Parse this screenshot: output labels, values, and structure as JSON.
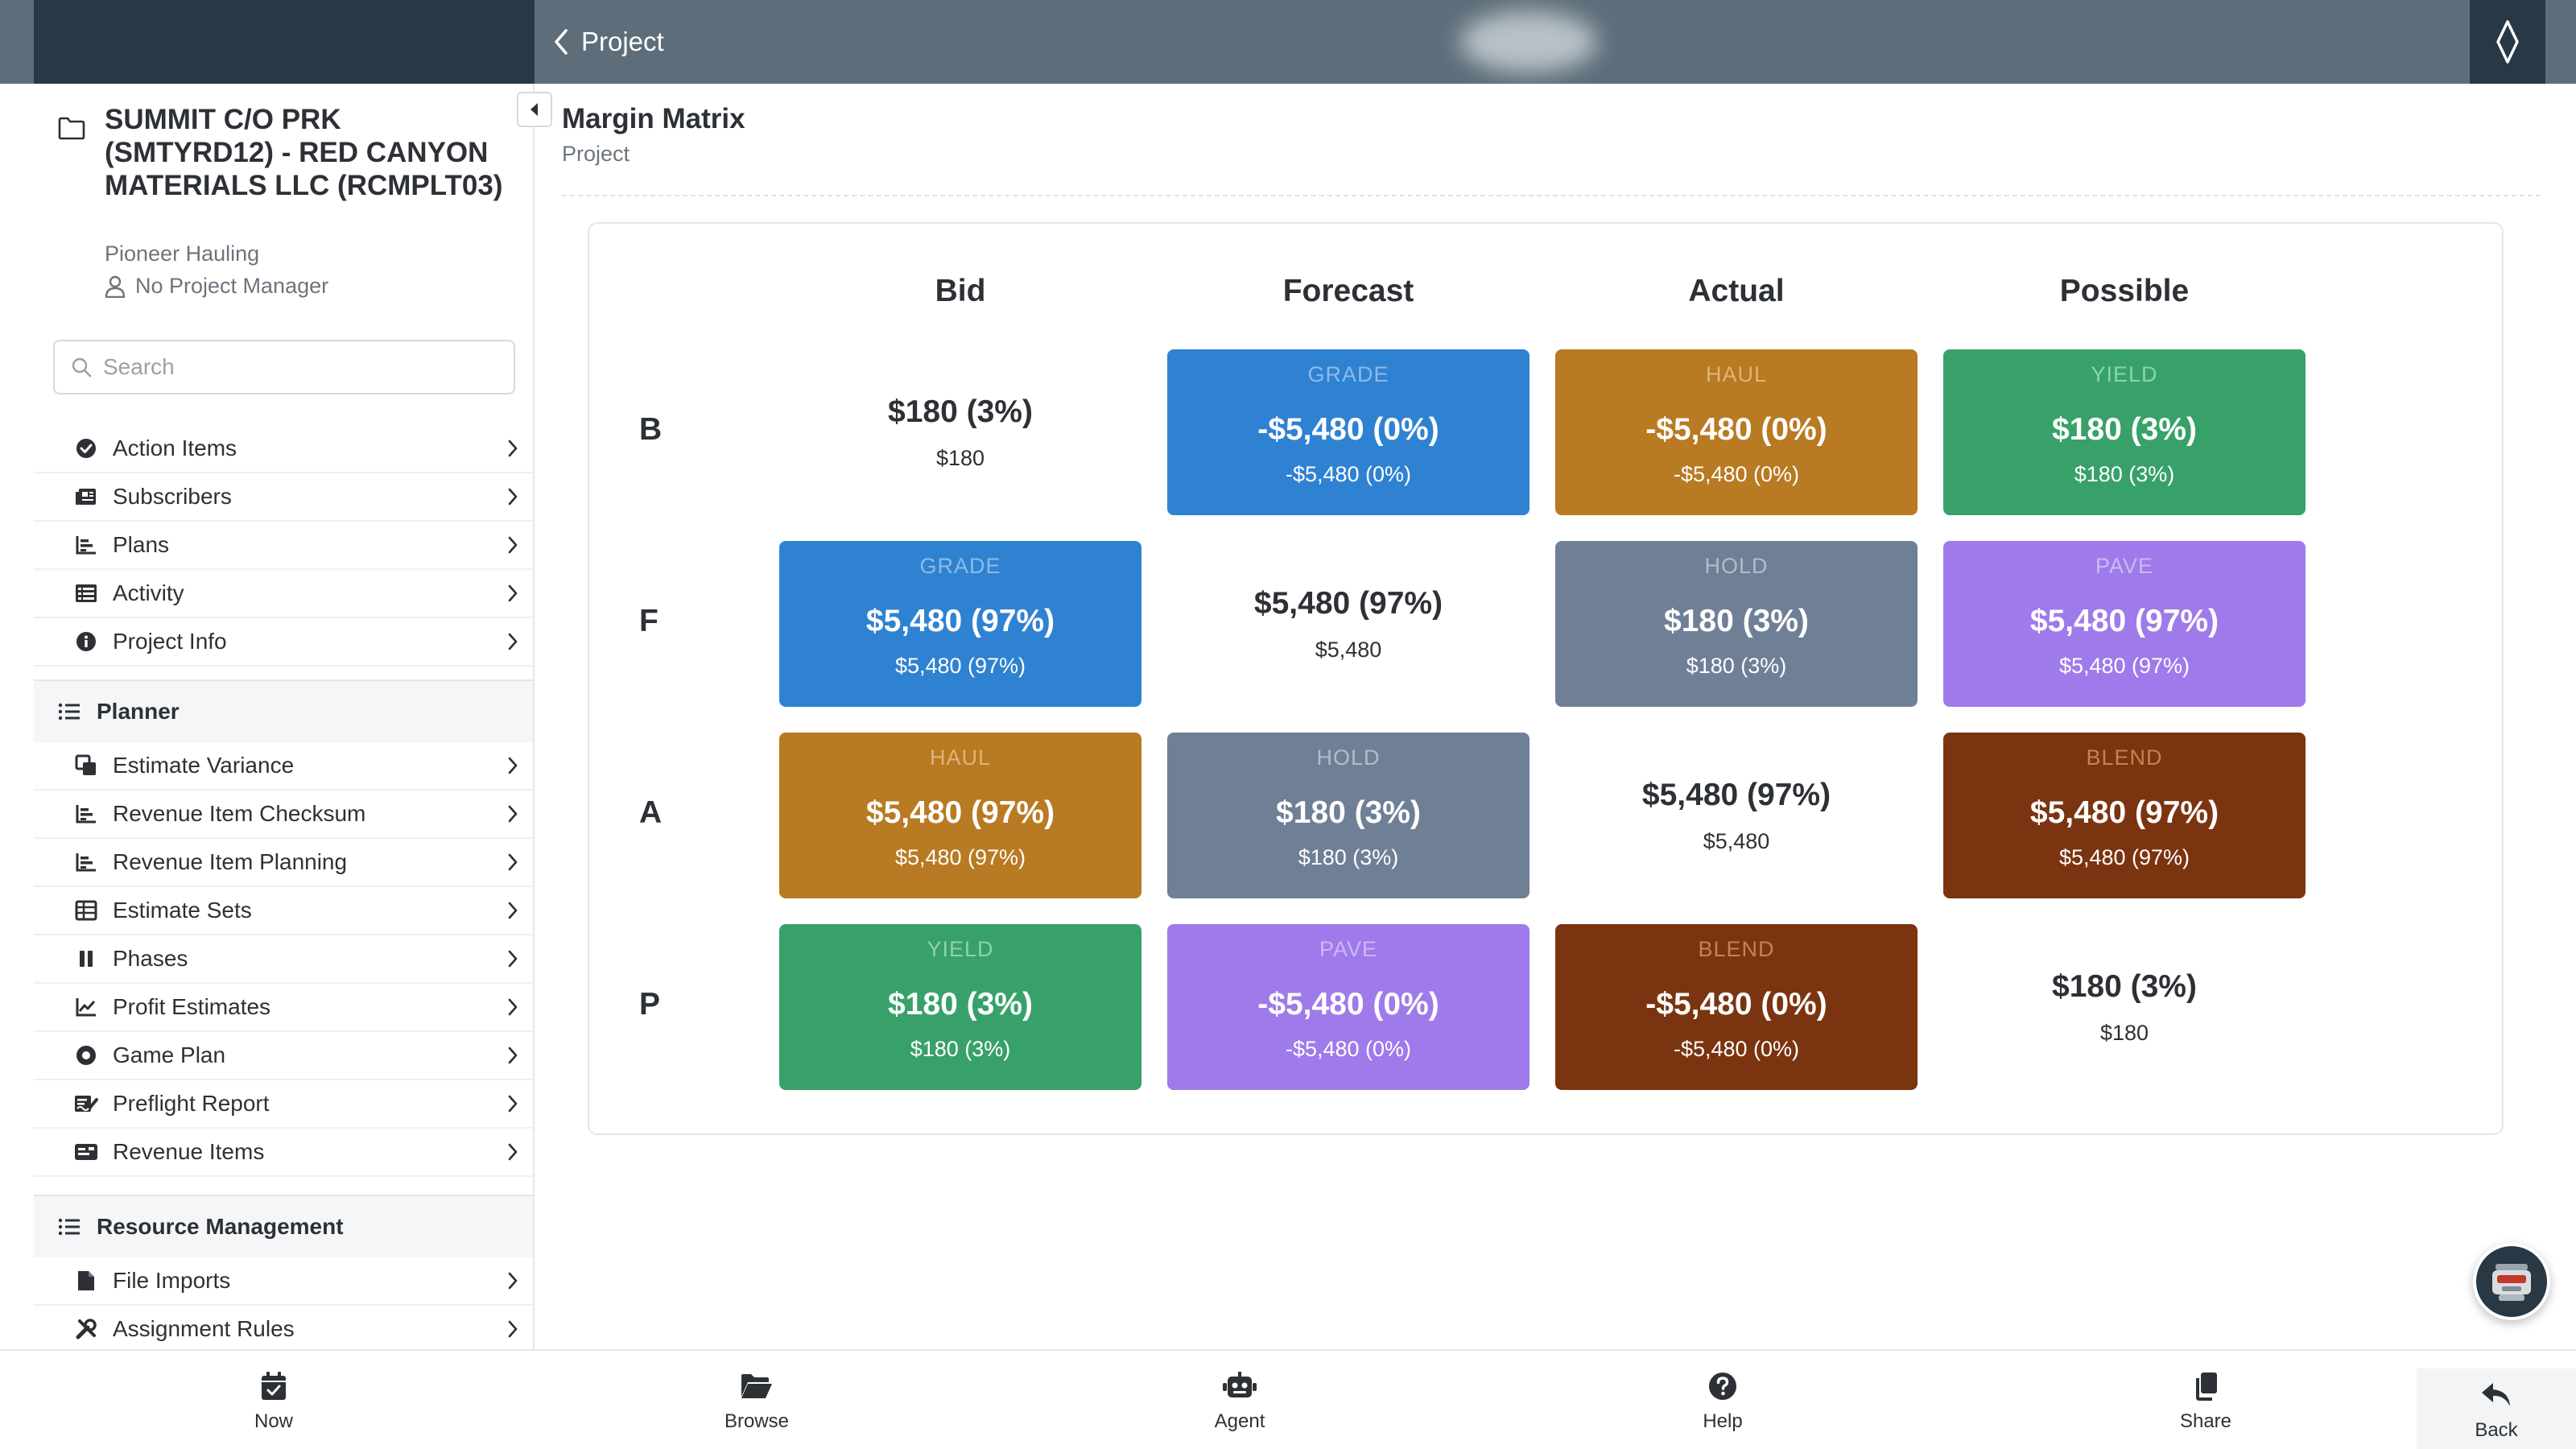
{
  "header": {
    "back_label": "Project"
  },
  "project": {
    "title": "SUMMIT C/O PRK (SMTYRD12) - RED CANYON MATERIALS LLC (RCMPLT03)",
    "company": "Pioneer Hauling",
    "manager": "No Project Manager"
  },
  "search": {
    "placeholder": "Search",
    "value": ""
  },
  "nav_top": [
    {
      "label": "Action Items",
      "icon": "check-circle-icon"
    },
    {
      "label": "Subscribers",
      "icon": "newspaper-icon"
    },
    {
      "label": "Plans",
      "icon": "chart-bar-icon"
    },
    {
      "label": "Activity",
      "icon": "list-icon"
    },
    {
      "label": "Project Info",
      "icon": "info-circle-icon"
    }
  ],
  "sections": {
    "planner": {
      "title": "Planner",
      "items": [
        {
          "label": "Estimate Variance",
          "icon": "clone-icon"
        },
        {
          "label": "Revenue Item Checksum",
          "icon": "chart-bar-icon"
        },
        {
          "label": "Revenue Item Planning",
          "icon": "chart-bar-icon"
        },
        {
          "label": "Estimate Sets",
          "icon": "table-icon"
        },
        {
          "label": "Phases",
          "icon": "pause-icon"
        },
        {
          "label": "Profit Estimates",
          "icon": "chart-line-icon"
        },
        {
          "label": "Game Plan",
          "icon": "dot-circle-icon"
        },
        {
          "label": "Preflight Report",
          "icon": "file-signature-icon"
        },
        {
          "label": "Revenue Items",
          "icon": "id-card-icon"
        }
      ]
    },
    "resource": {
      "title": "Resource Management",
      "items": [
        {
          "label": "File Imports",
          "icon": "file-icon"
        },
        {
          "label": "Assignment Rules",
          "icon": "tools-icon"
        }
      ]
    }
  },
  "main": {
    "title": "Margin Matrix",
    "subtitle": "Project"
  },
  "matrix": {
    "columns": [
      "Bid",
      "Forecast",
      "Actual",
      "Possible"
    ],
    "rows": [
      {
        "label": "B",
        "cells": [
          {
            "tag": "",
            "main": "$180 (3%)",
            "sub": "$180",
            "color": "plain"
          },
          {
            "tag": "GRADE",
            "main": "-$5,480 (0%)",
            "sub": "-$5,480 (0%)",
            "color": "blue"
          },
          {
            "tag": "HAUL",
            "main": "-$5,480 (0%)",
            "sub": "-$5,480 (0%)",
            "color": "orange"
          },
          {
            "tag": "YIELD",
            "main": "$180 (3%)",
            "sub": "$180 (3%)",
            "color": "green"
          }
        ]
      },
      {
        "label": "F",
        "cells": [
          {
            "tag": "GRADE",
            "main": "$5,480 (97%)",
            "sub": "$5,480 (97%)",
            "color": "blue"
          },
          {
            "tag": "",
            "main": "$5,480 (97%)",
            "sub": "$5,480",
            "color": "plain"
          },
          {
            "tag": "HOLD",
            "main": "$180 (3%)",
            "sub": "$180 (3%)",
            "color": "gray"
          },
          {
            "tag": "PAVE",
            "main": "$5,480 (97%)",
            "sub": "$5,480 (97%)",
            "color": "purple"
          }
        ]
      },
      {
        "label": "A",
        "cells": [
          {
            "tag": "HAUL",
            "main": "$5,480 (97%)",
            "sub": "$5,480 (97%)",
            "color": "orange"
          },
          {
            "tag": "HOLD",
            "main": "$180 (3%)",
            "sub": "$180 (3%)",
            "color": "gray"
          },
          {
            "tag": "",
            "main": "$5,480 (97%)",
            "sub": "$5,480",
            "color": "plain"
          },
          {
            "tag": "BLEND",
            "main": "$5,480 (97%)",
            "sub": "$5,480 (97%)",
            "color": "brown"
          }
        ]
      },
      {
        "label": "P",
        "cells": [
          {
            "tag": "YIELD",
            "main": "$180 (3%)",
            "sub": "$180 (3%)",
            "color": "green"
          },
          {
            "tag": "PAVE",
            "main": "-$5,480 (0%)",
            "sub": "-$5,480 (0%)",
            "color": "purple"
          },
          {
            "tag": "BLEND",
            "main": "-$5,480 (0%)",
            "sub": "-$5,480 (0%)",
            "color": "brown"
          },
          {
            "tag": "",
            "main": "$180 (3%)",
            "sub": "$180",
            "color": "plain"
          }
        ]
      }
    ]
  },
  "colors": {
    "topbar_dark": "#283845",
    "topbar_light": "#5d6e7a",
    "blue": "#2f82d1",
    "orange": "#b87a22",
    "green": "#38a169",
    "gray": "#6f7f96",
    "purple": "#9f7aea",
    "brown": "#7b3410"
  },
  "bottom_nav": [
    {
      "label": "Now",
      "icon": "calendar-check-icon"
    },
    {
      "label": "Browse",
      "icon": "folder-open-icon"
    },
    {
      "label": "Agent",
      "icon": "robot-icon"
    },
    {
      "label": "Help",
      "icon": "question-circle-icon"
    },
    {
      "label": "Share",
      "icon": "copy-icon"
    },
    {
      "label": "Back",
      "icon": "reply-icon"
    }
  ]
}
